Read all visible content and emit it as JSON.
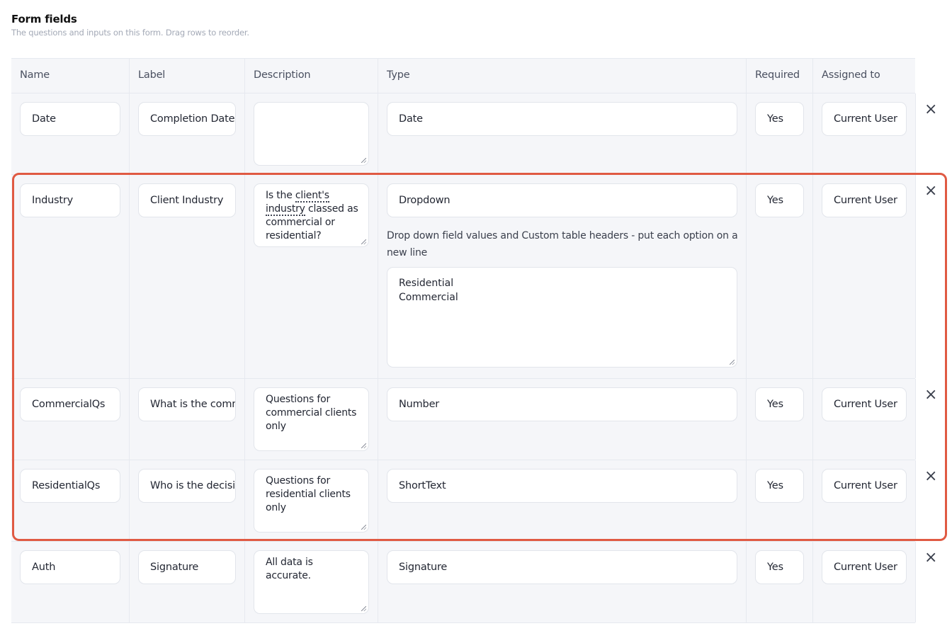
{
  "header": {
    "title": "Form fields",
    "subtitle": "The questions and inputs on this form. Drag rows to reorder."
  },
  "columns": {
    "name": "Name",
    "label": "Label",
    "description": "Description",
    "type": "Type",
    "required": "Required",
    "assigned": "Assigned to"
  },
  "rows": [
    {
      "name": "Date",
      "label": "Completion Date",
      "description": "",
      "type": "Date",
      "required": "Yes",
      "assigned": "Current User"
    },
    {
      "name": "Industry",
      "label": "Client Industry",
      "description_pre": "Is the ",
      "description_link": "client's industry",
      "description_post": " classed as commercial or residential?",
      "type": "Dropdown",
      "type_hint": "Drop down field values and Custom table headers - put each option on a new line",
      "options": [
        "Residential",
        "Commercial"
      ],
      "required": "Yes",
      "assigned": "Current User"
    },
    {
      "name": "CommercialQs",
      "label": "What is the commercial",
      "description": "Questions for commercial clients only",
      "type": "Number",
      "required": "Yes",
      "assigned": "Current User"
    },
    {
      "name": "ResidentialQs",
      "label": "Who is the decision",
      "description": "Questions for residential clients only",
      "type": "ShortText",
      "required": "Yes",
      "assigned": "Current User"
    },
    {
      "name": "Auth",
      "label": "Signature",
      "description": "All data is accurate.",
      "type": "Signature",
      "required": "Yes",
      "assigned": "Current User"
    }
  ],
  "icons": {
    "delete": "close-icon"
  },
  "colors": {
    "highlight": "#e05a43",
    "row_bg": "#f5f6f9"
  }
}
